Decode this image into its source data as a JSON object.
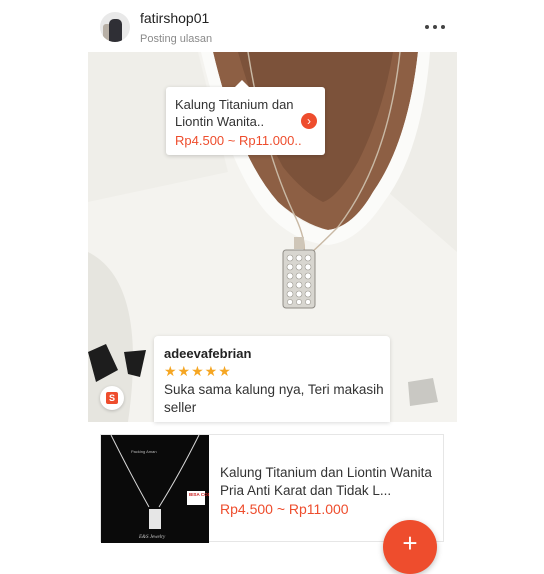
{
  "post": {
    "shop_name": "fatirshop01",
    "subtitle": "Posting ulasan"
  },
  "tag": {
    "title": "Kalung Titanium dan Liontin Wanita..",
    "price": "Rp4.500 ~ Rp11.000.."
  },
  "review": {
    "reviewer": "adeevafebrian",
    "rating": 5,
    "stars": "★★★★★",
    "text": "Suka sama kalung nya, Teri makasih seller"
  },
  "product": {
    "title": "Kalung Titanium dan Liontin Wanita Pria Anti Karat dan Tidak L...",
    "price": "Rp4.500 ~ Rp11.000",
    "thumb_caption": "Packing Aman",
    "thumb_badge": "BISA COD",
    "thumb_brand": "E&S Jewelry"
  },
  "badge_letter": "S",
  "fab_symbol": "+",
  "colors": {
    "accent": "#ee4d2d",
    "star": "#f5a623"
  }
}
